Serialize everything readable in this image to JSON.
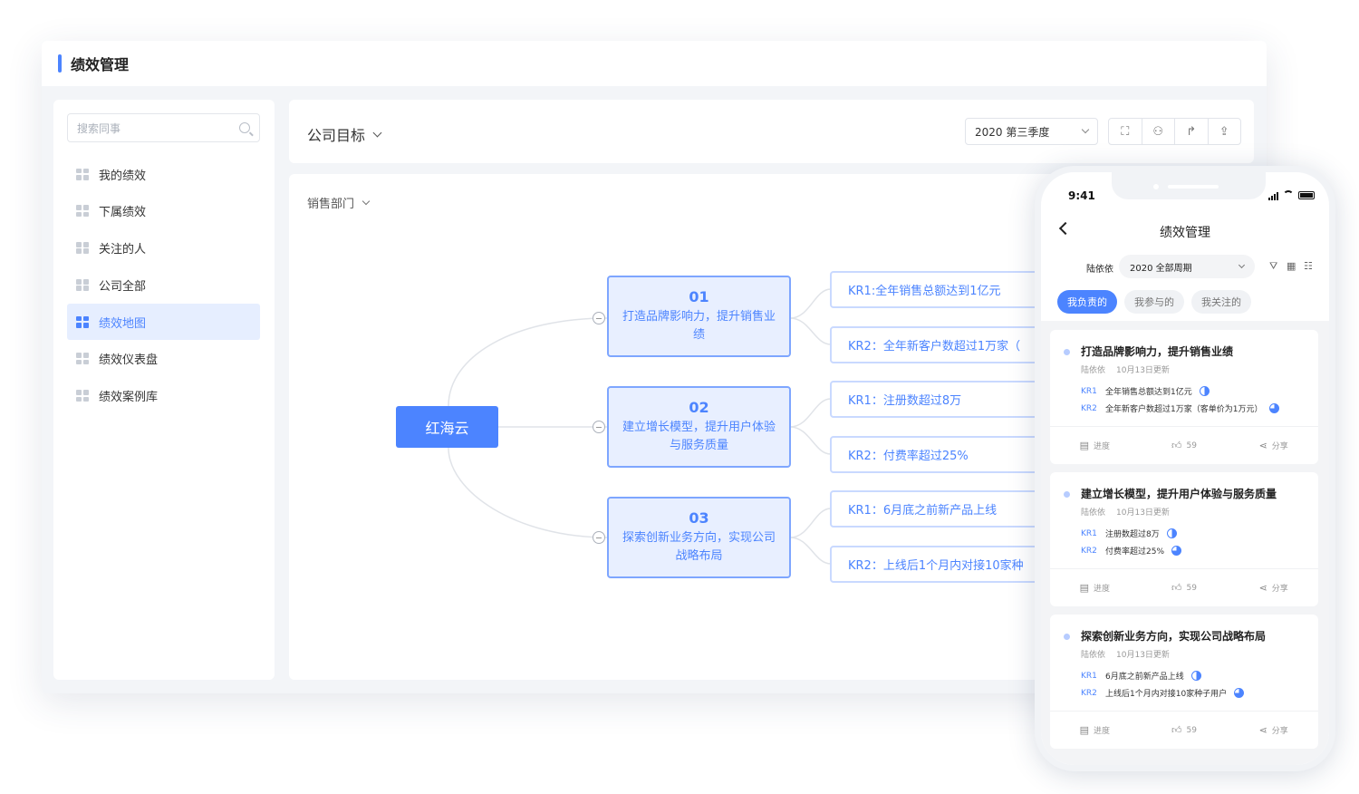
{
  "window": {
    "title": "绩效管理"
  },
  "sidebar": {
    "search_placeholder": "搜索同事",
    "items": [
      {
        "label": "我的绩效"
      },
      {
        "label": "下属绩效"
      },
      {
        "label": "关注的人"
      },
      {
        "label": "公司全部"
      },
      {
        "label": "绩效地图"
      },
      {
        "label": "绩效仪表盘"
      },
      {
        "label": "绩效案例库"
      }
    ],
    "active_index": 4
  },
  "header": {
    "goal_scope": "公司目标",
    "period": "2020 第三季度"
  },
  "canvas": {
    "department": "销售部门",
    "root": "红海云",
    "objectives": [
      {
        "num": "01",
        "text": "打造品牌影响力，提升销售业绩",
        "krs": [
          "KR1:全年销售总额达到1亿元",
          "KR2：全年新客户数超过1万家（"
        ]
      },
      {
        "num": "02",
        "text": "建立增长模型，提升用户体验与服务质量",
        "krs": [
          "KR1：注册数超过8万",
          "KR2：付费率超过25%"
        ]
      },
      {
        "num": "03",
        "text": "探索创新业务方向，实现公司战略布局",
        "krs": [
          "KR1：6月底之前新产品上线",
          "KR2：上线后1个月内对接10家种"
        ]
      }
    ]
  },
  "phone": {
    "time": "9:41",
    "title": "绩效管理",
    "owner": "陆依依",
    "cycle": "2020 全部周期",
    "tabs": [
      "我负责的",
      "我参与的",
      "我关注的"
    ],
    "cards": [
      {
        "title": "打造品牌影响力，提升销售业绩",
        "owner": "陆依依",
        "updated": "10月13日更新",
        "krs": [
          {
            "tag": "KR1",
            "text": "全年销售总额达到1亿元"
          },
          {
            "tag": "KR2",
            "text": "全年新客户数超过1万家（客单价为1万元）"
          }
        ],
        "progress_label": "进度",
        "likes": "59",
        "share_label": "分享"
      },
      {
        "title": "建立增长模型，提升用户体验与服务质量",
        "owner": "陆依依",
        "updated": "10月13日更新",
        "krs": [
          {
            "tag": "KR1",
            "text": "注册数超过8万"
          },
          {
            "tag": "KR2",
            "text": "付费率超过25%"
          }
        ],
        "progress_label": "进度",
        "likes": "59",
        "share_label": "分享"
      },
      {
        "title": "探索创新业务方向，实现公司战略布局",
        "owner": "陆依依",
        "updated": "10月13日更新",
        "krs": [
          {
            "tag": "KR1",
            "text": "6月底之前新产品上线"
          },
          {
            "tag": "KR2",
            "text": "上线后1个月内对接10家种子用户"
          }
        ],
        "progress_label": "进度",
        "likes": "59",
        "share_label": "分享"
      }
    ]
  },
  "colors": {
    "accent": "#4c84ff",
    "accent_light": "#e8efff"
  }
}
